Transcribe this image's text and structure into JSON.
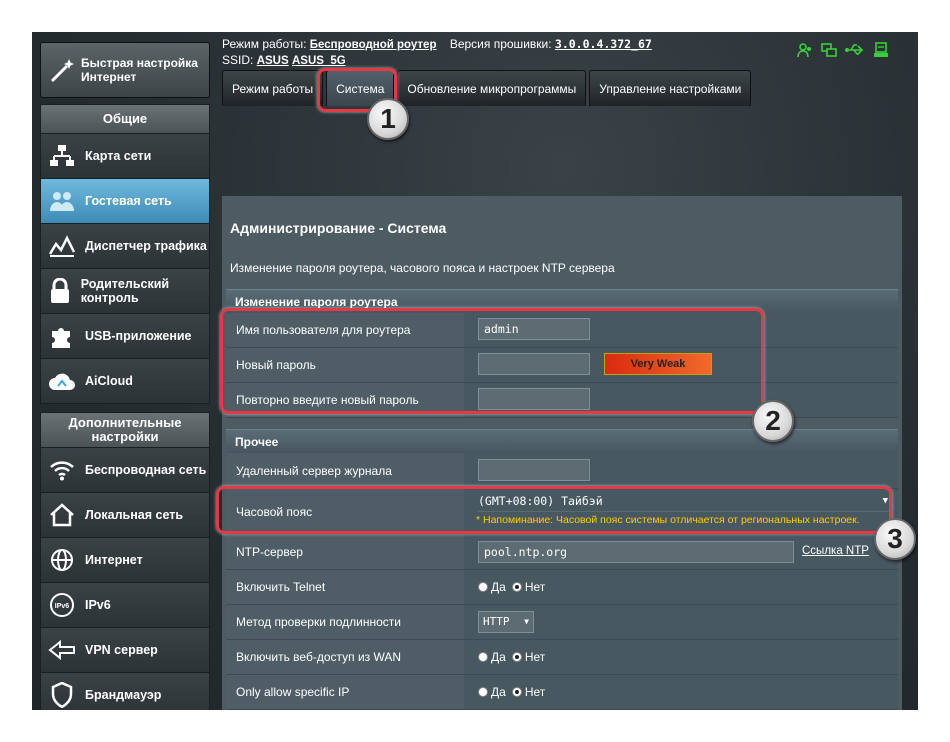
{
  "header": {
    "mode_label": "Режим работы:",
    "mode_value": "Беспроводной роутер",
    "firmware_label": "Версия прошивки:",
    "firmware_value": "3.0.0.4.372_67",
    "ssid_label": "SSID:",
    "ssid_1": "ASUS",
    "ssid_2": "ASUS_5G",
    "icons": [
      "users-icon",
      "network-icon",
      "usb-icon",
      "printer-icon"
    ],
    "icon_color": "#36d13a"
  },
  "sidebar": {
    "quick_setup": "Быстрая настройка Интернет",
    "general_header": "Общие",
    "general_items": [
      {
        "label": "Карта сети",
        "icon": "network-map-icon"
      },
      {
        "label": "Гостевая сеть",
        "icon": "guest-network-icon",
        "active": true
      },
      {
        "label": "Диспетчер трафика",
        "icon": "traffic-manager-icon"
      },
      {
        "label": "Родительский контроль",
        "icon": "lock-icon"
      },
      {
        "label": "USB-приложение",
        "icon": "puzzle-icon"
      },
      {
        "label": "AiCloud",
        "icon": "cloud-icon"
      }
    ],
    "advanced_header": "Дополнительные настройки",
    "advanced_items": [
      {
        "label": "Беспроводная сеть",
        "icon": "wifi-icon"
      },
      {
        "label": "Локальная сеть",
        "icon": "home-icon"
      },
      {
        "label": "Интернет",
        "icon": "globe-icon"
      },
      {
        "label": "IPv6",
        "icon": "ipv6-icon"
      },
      {
        "label": "VPN сервер",
        "icon": "vpn-icon"
      },
      {
        "label": "Брандмауэр",
        "icon": "shield-icon"
      }
    ]
  },
  "tabs": [
    {
      "label": "Режим работы",
      "active": false
    },
    {
      "label": "Система",
      "active": true
    },
    {
      "label": "Обновление микропрограммы",
      "active": false
    },
    {
      "label": "Управление настройками",
      "active": false
    }
  ],
  "panel": {
    "title": "Администрирование - Система",
    "description": "Изменение пароля роутера, часового пояса и настроек NTP сервера",
    "password_section": {
      "header": "Изменение пароля роутера",
      "username_label": "Имя пользователя для роутера",
      "username_value": "admin",
      "new_password_label": "Новый пароль",
      "strength_label": "Very Weak",
      "repeat_password_label": "Повторно введите новый пароль"
    },
    "misc_section": {
      "header": "Прочее",
      "log_server_label": "Удаленный сервер журнала",
      "timezone_label": "Часовой пояс",
      "timezone_value": "(GMT+08:00) Тайбэй",
      "timezone_warning": "* Напоминание: Часовой пояс системы отличается от региональных настроек.",
      "ntp_label": "NTP-сервер",
      "ntp_value": "pool.ntp.org",
      "ntp_link": "Ссылка NTP",
      "telnet_label": "Включить Telnet",
      "auth_label": "Метод проверки подлинности",
      "auth_value": "HTTP",
      "wan_label": "Включить веб-доступ из WAN",
      "specific_ip_label": "Only allow specific IP",
      "yes": "Да",
      "no": "Нет"
    }
  },
  "callouts": [
    "1",
    "2",
    "3"
  ],
  "colors": {
    "accent_active": "#4da3cf",
    "callout_red": "#e53a46",
    "warning_yellow": "#ffcc00",
    "strength_red": "#e13a12"
  }
}
